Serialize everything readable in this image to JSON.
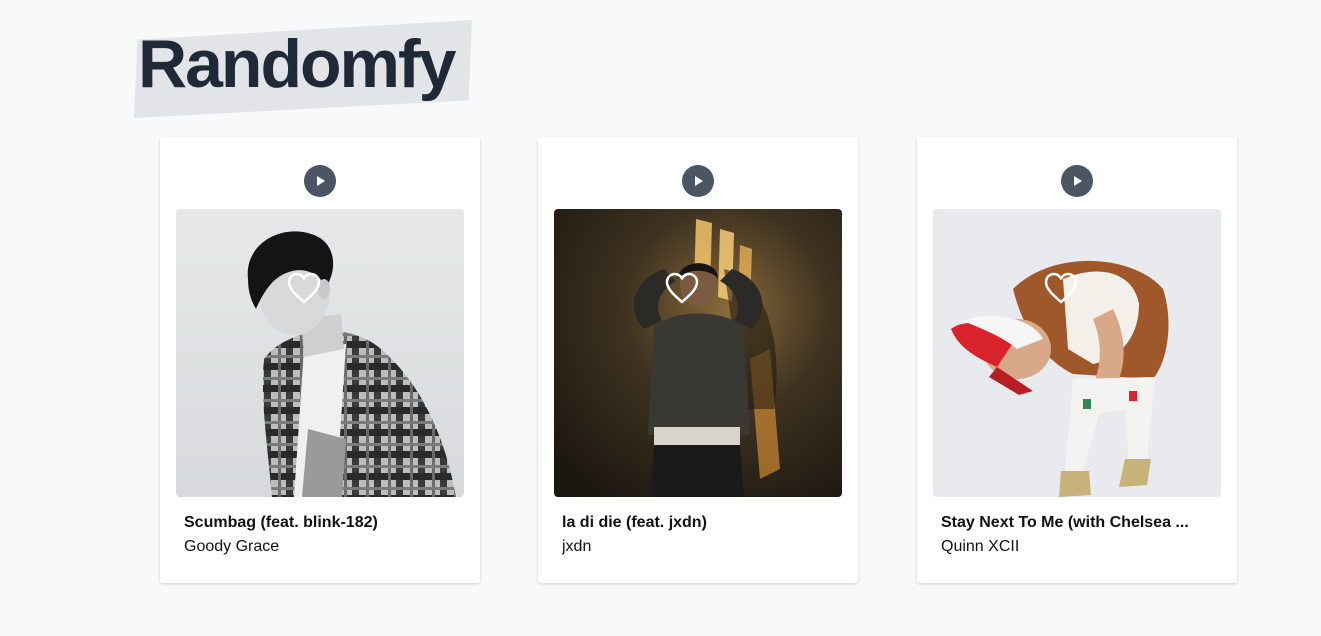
{
  "app": {
    "title": "Randomfy"
  },
  "tracks": [
    {
      "title": "Scumbag (feat. blink-182)",
      "artist": "Goody Grace",
      "play_icon": "play-icon",
      "like_icon": "heart-outline-icon"
    },
    {
      "title": "la di die (feat. jxdn)",
      "artist": "jxdn",
      "play_icon": "play-icon",
      "like_icon": "heart-outline-icon"
    },
    {
      "title": "Stay Next To Me (with Chelsea ...",
      "artist": "Quinn XCII",
      "play_icon": "play-icon",
      "like_icon": "heart-outline-icon"
    }
  ],
  "colors": {
    "background": "#f9f9f9",
    "logo_text": "#1f2937",
    "logo_highlight": "#e3e4e8",
    "play_button": "#4b5563"
  }
}
